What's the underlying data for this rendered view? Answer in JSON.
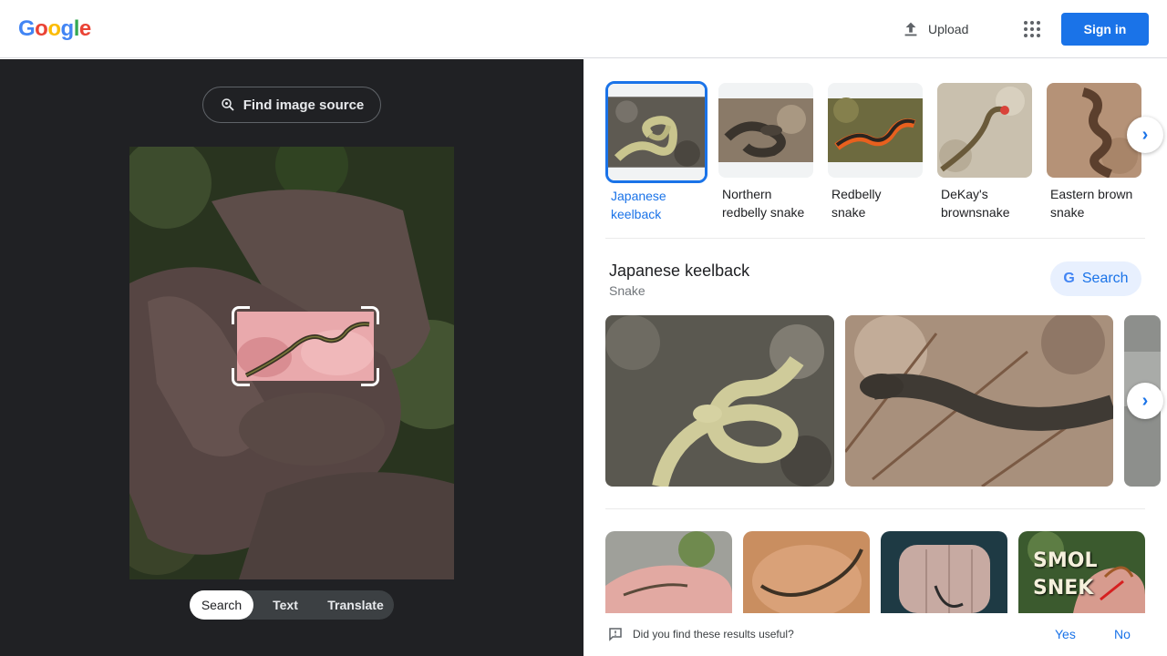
{
  "header": {
    "logo_letters": [
      "G",
      "o",
      "o",
      "g",
      "l",
      "e"
    ],
    "logo_colors": [
      "#4285f4",
      "#ea4335",
      "#fbbc05",
      "#4285f4",
      "#34a853",
      "#ea4335"
    ],
    "upload_label": "Upload",
    "signin_label": "Sign in"
  },
  "left": {
    "find_source_label": "Find image source",
    "tabs": [
      {
        "label": "Search",
        "active": true
      },
      {
        "label": "Text",
        "active": false
      },
      {
        "label": "Translate",
        "active": false
      }
    ]
  },
  "entities": [
    {
      "label_line1": "Japanese",
      "label_line2": "keelback",
      "selected": true
    },
    {
      "label_line1": "Northern",
      "label_line2": "redbelly snake",
      "selected": false
    },
    {
      "label_line1": "Redbelly",
      "label_line2": "snake",
      "selected": false
    },
    {
      "label_line1": "DeKay's",
      "label_line2": "brownsnake",
      "selected": false
    },
    {
      "label_line1": "Eastern brown",
      "label_line2": "snake",
      "selected": false
    }
  ],
  "knowledge_panel": {
    "title": "Japanese keelback",
    "subtitle": "Snake",
    "search_label": "Search"
  },
  "result_overlay_text": [
    "SMOL",
    "SNEK"
  ],
  "feedback": {
    "question": "Did you find these results useful?",
    "yes_label": "Yes",
    "no_label": "No"
  },
  "colors": {
    "accent": "#1a73e8",
    "left_bg": "#202124"
  }
}
